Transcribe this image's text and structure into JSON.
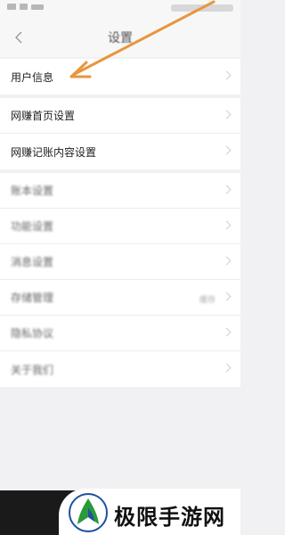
{
  "header": {
    "title": "设置"
  },
  "groups": [
    {
      "rows": [
        {
          "label": "用户信息"
        }
      ]
    },
    {
      "rows": [
        {
          "label": "网赚首页设置"
        },
        {
          "label": "网赚记账内容设置"
        }
      ]
    },
    {
      "rows": [
        {
          "label": "账本设置"
        },
        {
          "label": "功能设置"
        },
        {
          "label": "消息设置"
        },
        {
          "label": "存储管理",
          "value": "缓存"
        },
        {
          "label": "隐私协议"
        },
        {
          "label": "关于我们"
        }
      ]
    }
  ],
  "watermark": {
    "brand": "极限手游网"
  },
  "colors": {
    "arrow": "#e8963f",
    "logo_green": "#2a9a3a",
    "logo_blue": "#1f4fa3"
  }
}
